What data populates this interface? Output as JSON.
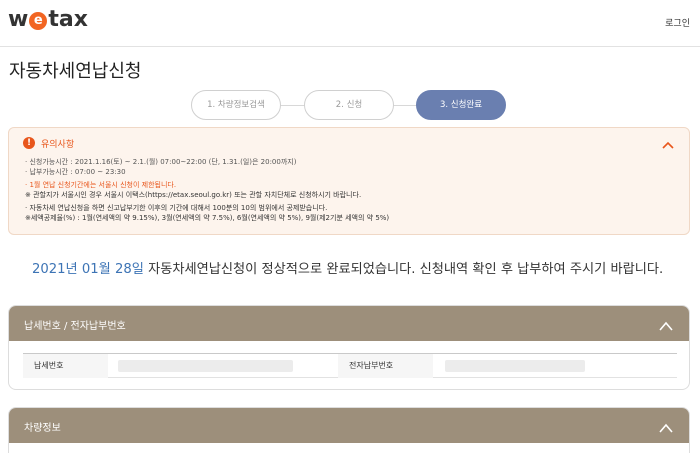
{
  "header": {
    "logo_letter_w": "w",
    "logo_letter_e": "e",
    "logo_rest": "tax",
    "login_label": "로그인"
  },
  "page": {
    "title": "자동차세연납신청"
  },
  "steps": [
    {
      "label": "1. 차량정보검색",
      "active": false
    },
    {
      "label": "2. 신청",
      "active": false
    },
    {
      "label": "3. 신청완료",
      "active": true
    }
  ],
  "notice": {
    "icon": "!",
    "title": "유의사항",
    "lines": [
      "· 신청가능시간 : 2021.1.16(토) ~ 2.1.(월) 07:00~22:00 (단, 1.31.(일)은 20:00까지)",
      "· 납부가능시간 : 07:00 ~ 23:30",
      "· 1월 연납 신청기간에는 서울시 신청이 제한됩니다.",
      "※ 관할지가 서울시인 경우 서울시 이택스(https://etax.seoul.go.kr) 또는 관할 자치단체로 신청하시기 바랍니다.",
      "· 자동차세 연납신청을 하면 신고납부기한 이후의 기간에 대해서 100분의 10의 범위에서 공제받습니다.",
      "※세액공제율(%) : 1월(연세액의 약 9.15%), 3월(연세액의 약 7.5%), 6월(연세액의 약 5%), 9월(제2기분 세액의 약 5%)"
    ]
  },
  "completion": {
    "date": "2021년 01월 28일",
    "message": " 자동차세연납신청이 정상적으로 완료되었습니다. 신청내역 확인 후 납부하여 주시기 바랍니다."
  },
  "panels": {
    "payment": {
      "title": "납세번호 / 전자납부번호",
      "tax_number_label": "납세번호",
      "epay_number_label": "전자납부번호"
    },
    "vehicle": {
      "title": "차량정보"
    }
  },
  "colors": {
    "accent_orange": "#e8561c",
    "step_active": "#6a7fb0",
    "panel_header": "#9d8f7b",
    "date_blue": "#3d74b5"
  }
}
